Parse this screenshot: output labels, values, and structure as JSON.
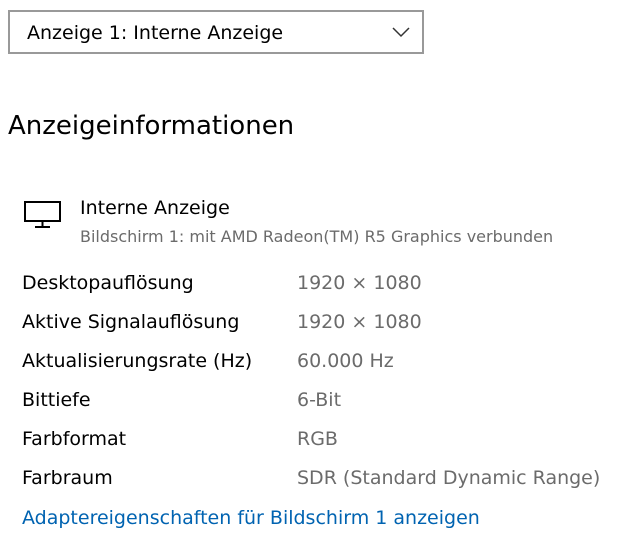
{
  "display_select": {
    "value": "Anzeige 1: Interne Anzeige",
    "chevron_icon": "chevron-down-icon"
  },
  "section": {
    "title": "Anzeigeinformationen"
  },
  "display": {
    "icon": "monitor-icon",
    "name": "Interne Anzeige",
    "subtitle": "Bildschirm 1: mit AMD Radeon(TM) R5 Graphics verbunden"
  },
  "info_rows": [
    {
      "label": "Desktopauflösung",
      "value": "1920 × 1080"
    },
    {
      "label": "Aktive Signalauflösung",
      "value": "1920 × 1080"
    },
    {
      "label": "Aktualisierungsrate (Hz)",
      "value": "60.000 Hz"
    },
    {
      "label": "Bittiefe",
      "value": "6-Bit"
    },
    {
      "label": "Farbformat",
      "value": "RGB"
    },
    {
      "label": "Farbraum",
      "value": "SDR (Standard Dynamic Range)"
    }
  ],
  "adapter_link": {
    "label": "Adaptereigenschaften für Bildschirm 1 anzeigen"
  },
  "colors": {
    "link": "#0063b1",
    "secondary_text": "#6b6b6b",
    "select_border": "#999999"
  }
}
